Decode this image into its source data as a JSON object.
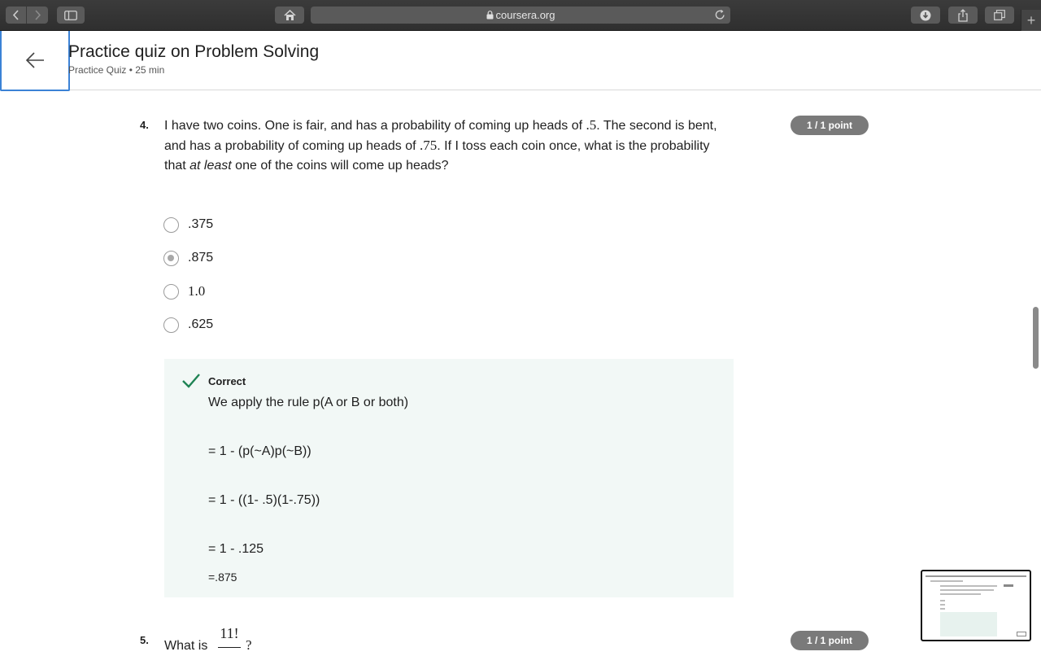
{
  "browser": {
    "url": "coursera.org",
    "icons": [
      "chevron-left-icon",
      "chevron-right-icon",
      "sidebar-icon",
      "home-icon",
      "lock-icon",
      "reload-icon",
      "download-icon",
      "share-icon",
      "tabs-icon",
      "plus-icon"
    ]
  },
  "header": {
    "title": "Practice quiz on Problem Solving",
    "subtitle": "Practice Quiz • 25 min"
  },
  "question4": {
    "number": "4.",
    "score": "1 / 1 point",
    "text": {
      "a": "I have two coins. One is fair, and has a probability of coming up heads of ",
      "b": ".5",
      "c": ". The second is bent, and has a probability of coming up heads of ",
      "d": ".75",
      "e": ". If I toss each coin once, what is the probability that ",
      "emph": "at least",
      "f": " one of the coins will come up heads?"
    },
    "options": [
      {
        "label": ".375",
        "selected": false
      },
      {
        "label": ".875",
        "selected": true
      },
      {
        "label": "1.0",
        "selected": false
      },
      {
        "label": ".625",
        "selected": false
      }
    ],
    "feedback": {
      "status": "Correct",
      "lines": [
        "We apply the rule p(A or B or both)",
        "= 1 - (p(~A)p(~B))",
        "= 1 - ((1- .5)(1-.75))",
        "= 1 - .125",
        "=.875"
      ]
    }
  },
  "question5": {
    "number": "5.",
    "score": "1 / 1 point",
    "prefix": "What is",
    "fraction_num": "11!",
    "suffix": "?"
  },
  "colors": {
    "accent_focus": "#3b82d6",
    "feedback_bg": "#f2f8f6",
    "check_green": "#1f8354",
    "badge_gray": "#7a7a7a"
  }
}
